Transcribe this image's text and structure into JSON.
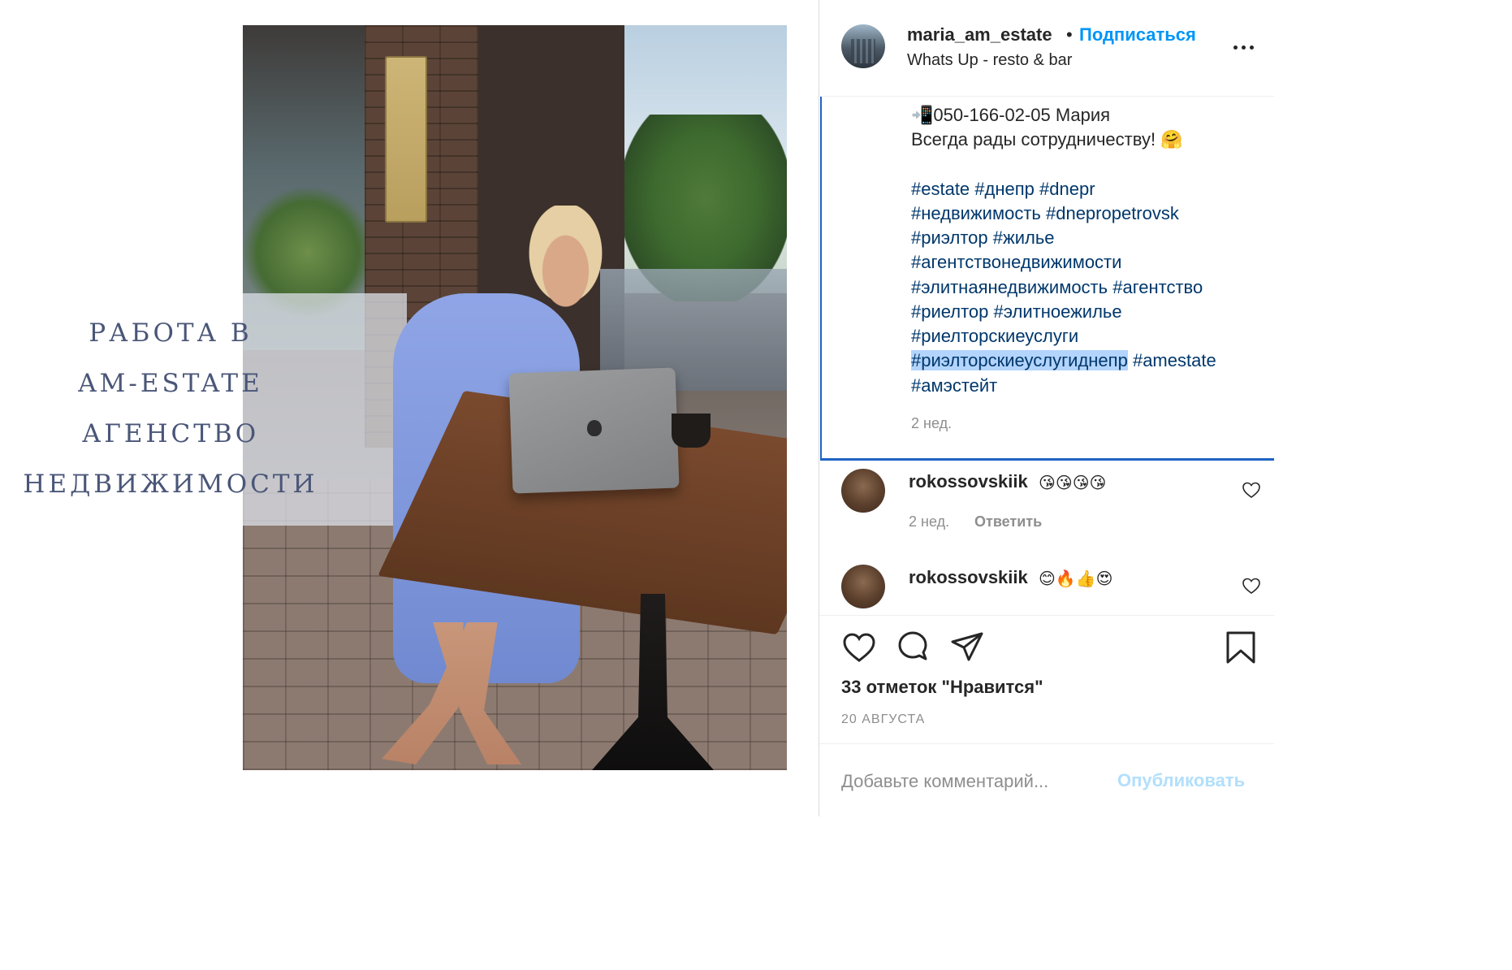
{
  "post": {
    "image_heading": [
      "РАБОТА В",
      "AM-ESTATE",
      "АГЕНСТВО",
      "НЕДВИЖИМОСТИ"
    ]
  },
  "header": {
    "username": "maria_am_estate",
    "separator": "•",
    "follow_label": "Подписаться",
    "location": "Whats Up - resto & bar",
    "more_icon": "more-horizontal-icon"
  },
  "caption": {
    "phone_icon": "📲",
    "phone_line": "050-166-02-05 Мария",
    "greeting": "Всегда рады сотрудничеству! 🤗",
    "hashtag_lines": [
      [
        "#estate",
        "#днепр",
        "#dnepr"
      ],
      [
        "#недвижимость",
        "#dnepropetrovsk"
      ],
      [
        "#риэлтор",
        "#жилье"
      ],
      [
        "#агентствонедвижимости"
      ],
      [
        "#элитнаянедвижимость",
        "#агентство"
      ],
      [
        "#риелтор",
        "#элитноежилье"
      ],
      [
        "#риелторскиеуслуги"
      ],
      [
        "#риэлторскиеуслугиднепр",
        "#amestate"
      ],
      [
        "#амэстейт"
      ]
    ],
    "time": "2 нед."
  },
  "comments": [
    {
      "username": "rokossovskiik",
      "text": "😘😘😘😘",
      "time": "2 нед.",
      "reply_label": "Ответить"
    },
    {
      "username": "rokossovskiik",
      "text": "😊🔥👍😍"
    }
  ],
  "actions": {
    "icons": [
      "heart-icon",
      "comment-icon",
      "share-icon",
      "bookmark-icon"
    ],
    "likes_text": "33 отметок \"Нравится\"",
    "date": "20 АВГУСТА"
  },
  "comment_input": {
    "placeholder": "Добавьте комментарий...",
    "publish_label": "Опубликовать"
  },
  "colors": {
    "link_blue": "#0095f6",
    "hashtag": "#00376b",
    "selection_highlight": "#b3d4fc",
    "caption_border": "#1f63c4",
    "overlay_text": "#4a5678"
  }
}
